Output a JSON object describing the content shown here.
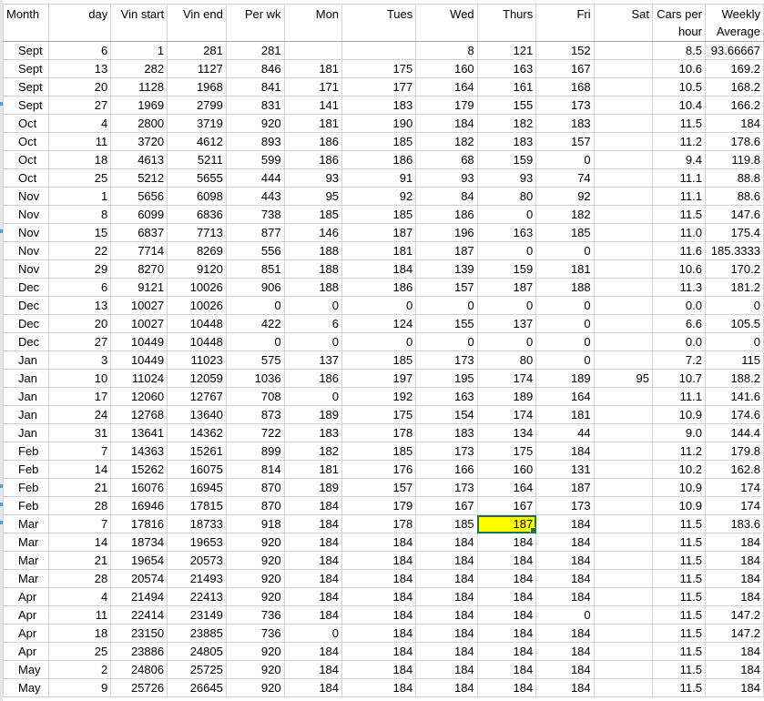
{
  "headers": [
    "Month",
    "day",
    "Vin start",
    "Vin end",
    "Per wk",
    "Mon",
    "Tues",
    "Wed",
    "Thurs",
    "Fri",
    "Sat",
    "Cars per hour",
    "Weekly Average"
  ],
  "header_lines": {
    "cars_per_hour": [
      "Cars per",
      "hour"
    ],
    "weekly_average": [
      "Weekly",
      "Average"
    ]
  },
  "rows": [
    [
      "Sept",
      "6",
      "1",
      "281",
      "281",
      "",
      "",
      "8",
      "121",
      "152",
      "",
      "8.5",
      "93.66667"
    ],
    [
      "Sept",
      "13",
      "282",
      "1127",
      "846",
      "181",
      "175",
      "160",
      "163",
      "167",
      "",
      "10.6",
      "169.2"
    ],
    [
      "Sept",
      "20",
      "1128",
      "1968",
      "841",
      "171",
      "177",
      "164",
      "161",
      "168",
      "",
      "10.5",
      "168.2"
    ],
    [
      "Sept",
      "27",
      "1969",
      "2799",
      "831",
      "141",
      "183",
      "179",
      "155",
      "173",
      "",
      "10.4",
      "166.2"
    ],
    [
      "Oct",
      "4",
      "2800",
      "3719",
      "920",
      "181",
      "190",
      "184",
      "182",
      "183",
      "",
      "11.5",
      "184"
    ],
    [
      "Oct",
      "11",
      "3720",
      "4612",
      "893",
      "186",
      "185",
      "182",
      "183",
      "157",
      "",
      "11.2",
      "178.6"
    ],
    [
      "Oct",
      "18",
      "4613",
      "5211",
      "599",
      "186",
      "186",
      "68",
      "159",
      "0",
      "",
      "9.4",
      "119.8"
    ],
    [
      "Oct",
      "25",
      "5212",
      "5655",
      "444",
      "93",
      "91",
      "93",
      "93",
      "74",
      "",
      "11.1",
      "88.8"
    ],
    [
      "Nov",
      "1",
      "5656",
      "6098",
      "443",
      "95",
      "92",
      "84",
      "80",
      "92",
      "",
      "11.1",
      "88.6"
    ],
    [
      "Nov",
      "8",
      "6099",
      "6836",
      "738",
      "185",
      "185",
      "186",
      "0",
      "182",
      "",
      "11.5",
      "147.6"
    ],
    [
      "Nov",
      "15",
      "6837",
      "7713",
      "877",
      "146",
      "187",
      "196",
      "163",
      "185",
      "",
      "11.0",
      "175.4"
    ],
    [
      "Nov",
      "22",
      "7714",
      "8269",
      "556",
      "188",
      "181",
      "187",
      "0",
      "0",
      "",
      "11.6",
      "185.3333"
    ],
    [
      "Nov",
      "29",
      "8270",
      "9120",
      "851",
      "188",
      "184",
      "139",
      "159",
      "181",
      "",
      "10.6",
      "170.2"
    ],
    [
      "Dec",
      "6",
      "9121",
      "10026",
      "906",
      "188",
      "186",
      "157",
      "187",
      "188",
      "",
      "11.3",
      "181.2"
    ],
    [
      "Dec",
      "13",
      "10027",
      "10026",
      "0",
      "0",
      "0",
      "0",
      "0",
      "0",
      "",
      "0.0",
      "0"
    ],
    [
      "Dec",
      "20",
      "10027",
      "10448",
      "422",
      "6",
      "124",
      "155",
      "137",
      "0",
      "",
      "6.6",
      "105.5"
    ],
    [
      "Dec",
      "27",
      "10449",
      "10448",
      "0",
      "0",
      "0",
      "0",
      "0",
      "0",
      "",
      "0.0",
      "0"
    ],
    [
      "Jan",
      "3",
      "10449",
      "11023",
      "575",
      "137",
      "185",
      "173",
      "80",
      "0",
      "",
      "7.2",
      "115"
    ],
    [
      "Jan",
      "10",
      "11024",
      "12059",
      "1036",
      "186",
      "197",
      "195",
      "174",
      "189",
      "95",
      "10.7",
      "188.2"
    ],
    [
      "Jan",
      "17",
      "12060",
      "12767",
      "708",
      "0",
      "192",
      "163",
      "189",
      "164",
      "",
      "11.1",
      "141.6"
    ],
    [
      "Jan",
      "24",
      "12768",
      "13640",
      "873",
      "189",
      "175",
      "154",
      "174",
      "181",
      "",
      "10.9",
      "174.6"
    ],
    [
      "Jan",
      "31",
      "13641",
      "14362",
      "722",
      "183",
      "178",
      "183",
      "134",
      "44",
      "",
      "9.0",
      "144.4"
    ],
    [
      "Feb",
      "7",
      "14363",
      "15261",
      "899",
      "182",
      "185",
      "173",
      "175",
      "184",
      "",
      "11.2",
      "179.8"
    ],
    [
      "Feb",
      "14",
      "15262",
      "16075",
      "814",
      "181",
      "176",
      "166",
      "160",
      "131",
      "",
      "10.2",
      "162.8"
    ],
    [
      "Feb",
      "21",
      "16076",
      "16945",
      "870",
      "189",
      "157",
      "173",
      "164",
      "187",
      "",
      "10.9",
      "174"
    ],
    [
      "Feb",
      "28",
      "16946",
      "17815",
      "870",
      "184",
      "179",
      "167",
      "167",
      "173",
      "",
      "10.9",
      "174"
    ],
    [
      "Mar",
      "7",
      "17816",
      "18733",
      "918",
      "184",
      "178",
      "185",
      "187",
      "184",
      "",
      "11.5",
      "183.6"
    ],
    [
      "Mar",
      "14",
      "18734",
      "19653",
      "920",
      "184",
      "184",
      "184",
      "184",
      "184",
      "",
      "11.5",
      "184"
    ],
    [
      "Mar",
      "21",
      "19654",
      "20573",
      "920",
      "184",
      "184",
      "184",
      "184",
      "184",
      "",
      "11.5",
      "184"
    ],
    [
      "Mar",
      "28",
      "20574",
      "21493",
      "920",
      "184",
      "184",
      "184",
      "184",
      "184",
      "",
      "11.5",
      "184"
    ],
    [
      "Apr",
      "4",
      "21494",
      "22413",
      "920",
      "184",
      "184",
      "184",
      "184",
      "184",
      "",
      "11.5",
      "184"
    ],
    [
      "Apr",
      "11",
      "22414",
      "23149",
      "736",
      "184",
      "184",
      "184",
      "184",
      "0",
      "",
      "11.5",
      "147.2"
    ],
    [
      "Apr",
      "18",
      "23150",
      "23885",
      "736",
      "0",
      "184",
      "184",
      "184",
      "184",
      "",
      "11.5",
      "147.2"
    ],
    [
      "Apr",
      "25",
      "23886",
      "24805",
      "920",
      "184",
      "184",
      "184",
      "184",
      "184",
      "",
      "11.5",
      "184"
    ],
    [
      "May",
      "2",
      "24806",
      "25725",
      "920",
      "184",
      "184",
      "184",
      "184",
      "184",
      "",
      "11.5",
      "184"
    ],
    [
      "May",
      "9",
      "25726",
      "26645",
      "920",
      "184",
      "184",
      "184",
      "184",
      "184",
      "",
      "11.5",
      "184"
    ]
  ],
  "selected_cell": {
    "row": 26,
    "col": 8
  },
  "colors": {
    "gridline": "#d4d4d4",
    "selection_fill": "#ffff00",
    "selection_border": "#217346"
  }
}
